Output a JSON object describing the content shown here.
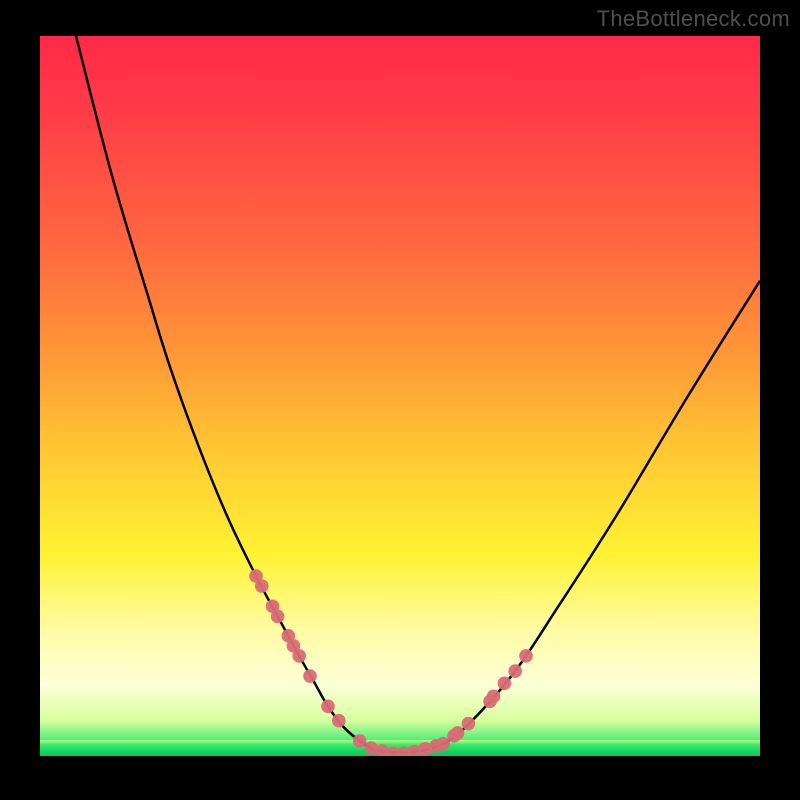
{
  "watermark": "TheBottleneck.com",
  "chart_data": {
    "type": "line",
    "title": "",
    "xlabel": "",
    "ylabel": "",
    "xlim": [
      0,
      100
    ],
    "ylim": [
      0,
      100
    ],
    "grid": false,
    "legend": false,
    "series": [
      {
        "name": "bottleneck-curve",
        "kind": "line",
        "color": "#000000",
        "x": [
          5,
          10,
          15,
          18,
          22,
          26,
          30,
          33,
          36,
          38,
          40,
          42,
          44,
          46,
          48,
          52,
          56,
          60,
          66,
          72,
          80,
          90,
          100
        ],
        "y": [
          100,
          80.6,
          63.9,
          54.2,
          43.1,
          33.3,
          25.0,
          19.4,
          13.9,
          10.4,
          6.9,
          4.2,
          2.4,
          1.1,
          0.6,
          0.6,
          1.7,
          4.9,
          11.8,
          20.8,
          33.3,
          50.0,
          66.0
        ]
      },
      {
        "name": "highlight-dots-left",
        "kind": "scatter",
        "color": "#d96c75",
        "x": [
          30,
          30.8,
          32.3,
          33,
          34.5,
          35.2,
          36,
          37.5,
          40,
          41.5
        ],
        "y": [
          25.0,
          23.6,
          20.8,
          19.4,
          16.7,
          15.3,
          13.9,
          11.1,
          6.9,
          4.9
        ]
      },
      {
        "name": "highlight-dots-bottom",
        "kind": "scatter",
        "color": "#d96c75",
        "x": [
          44.4,
          46,
          47.5,
          49,
          50.5,
          52,
          53.5,
          55
        ],
        "y": [
          2.1,
          1.1,
          0.7,
          0.4,
          0.4,
          0.6,
          1.0,
          1.4
        ]
      },
      {
        "name": "highlight-dots-right",
        "kind": "scatter",
        "color": "#d96c75",
        "x": [
          56,
          57.5,
          58,
          59.5,
          62.5,
          63,
          64.5,
          66,
          67.5
        ],
        "y": [
          1.7,
          2.8,
          3.2,
          4.5,
          7.6,
          8.3,
          10.1,
          11.8,
          13.9
        ]
      }
    ],
    "gradient_colors": {
      "top": "#ff2a47",
      "mid_high": "#ff9a37",
      "mid": "#fff233",
      "mid_low": "#fdffd6",
      "bottom": "#0fc657"
    },
    "annotations": []
  }
}
